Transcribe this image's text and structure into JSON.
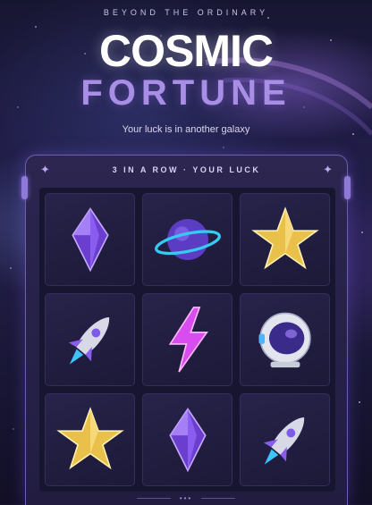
{
  "header": {
    "tagline": "BEYOND THE ORDINARY",
    "title_line1": "COSMIC",
    "title_line2": "FORTUNE",
    "subtitle": "Your luck is in another galaxy"
  },
  "machine": {
    "label": "3 IN A ROW · YOUR LUCK",
    "pagination": "•••"
  },
  "reels": [
    [
      "crystal-icon",
      "planet-icon",
      "star-icon"
    ],
    [
      "rocket-icon",
      "lightning-icon",
      "astronaut-helmet-icon"
    ],
    [
      "star-icon",
      "crystal-icon",
      "rocket-icon"
    ]
  ],
  "colors": {
    "accent": "#a98ee6",
    "frame": "#6b5fb0",
    "gold": "#e9c04a",
    "crystal": "#8a5df0",
    "neon_pink": "#d94cf0"
  }
}
